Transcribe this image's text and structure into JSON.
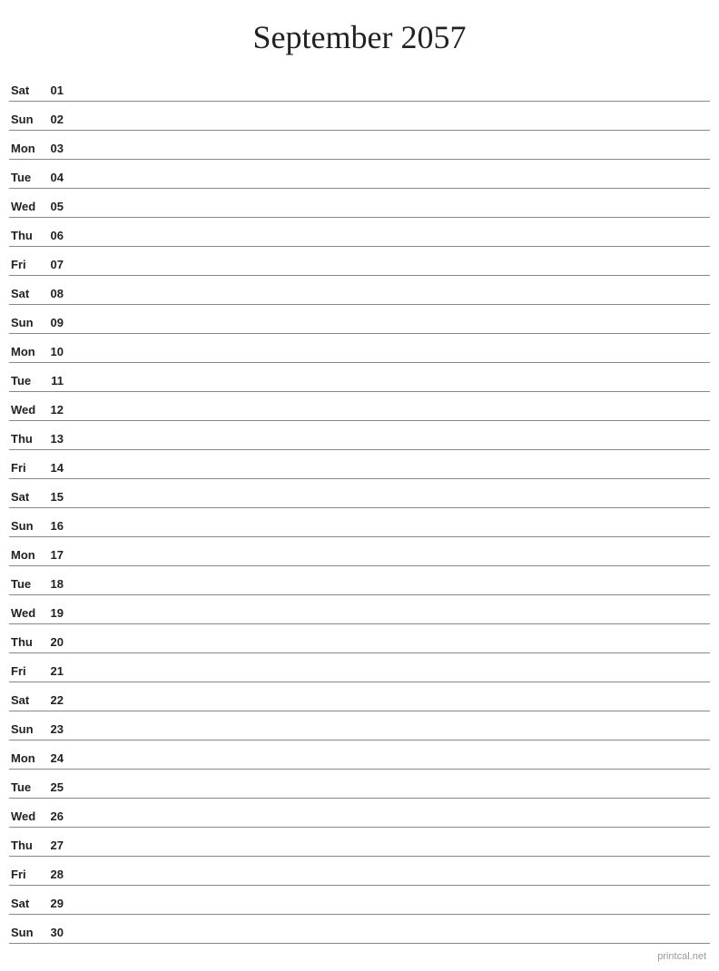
{
  "title": "September 2057",
  "watermark": "printcal.net",
  "days": [
    {
      "name": "Sat",
      "num": "01"
    },
    {
      "name": "Sun",
      "num": "02"
    },
    {
      "name": "Mon",
      "num": "03"
    },
    {
      "name": "Tue",
      "num": "04"
    },
    {
      "name": "Wed",
      "num": "05"
    },
    {
      "name": "Thu",
      "num": "06"
    },
    {
      "name": "Fri",
      "num": "07"
    },
    {
      "name": "Sat",
      "num": "08"
    },
    {
      "name": "Sun",
      "num": "09"
    },
    {
      "name": "Mon",
      "num": "10"
    },
    {
      "name": "Tue",
      "num": "11"
    },
    {
      "name": "Wed",
      "num": "12"
    },
    {
      "name": "Thu",
      "num": "13"
    },
    {
      "name": "Fri",
      "num": "14"
    },
    {
      "name": "Sat",
      "num": "15"
    },
    {
      "name": "Sun",
      "num": "16"
    },
    {
      "name": "Mon",
      "num": "17"
    },
    {
      "name": "Tue",
      "num": "18"
    },
    {
      "name": "Wed",
      "num": "19"
    },
    {
      "name": "Thu",
      "num": "20"
    },
    {
      "name": "Fri",
      "num": "21"
    },
    {
      "name": "Sat",
      "num": "22"
    },
    {
      "name": "Sun",
      "num": "23"
    },
    {
      "name": "Mon",
      "num": "24"
    },
    {
      "name": "Tue",
      "num": "25"
    },
    {
      "name": "Wed",
      "num": "26"
    },
    {
      "name": "Thu",
      "num": "27"
    },
    {
      "name": "Fri",
      "num": "28"
    },
    {
      "name": "Sat",
      "num": "29"
    },
    {
      "name": "Sun",
      "num": "30"
    }
  ]
}
